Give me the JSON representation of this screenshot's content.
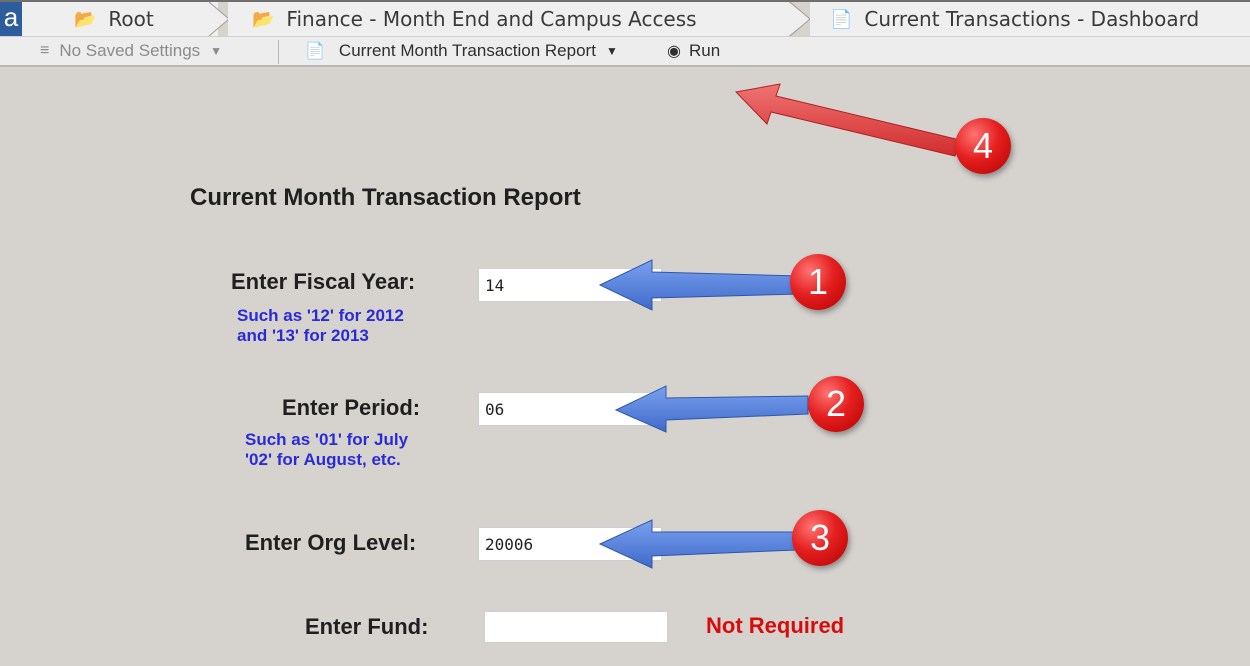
{
  "breadcrumb": {
    "logo_text": "a",
    "items": [
      {
        "label": "Root",
        "icon": "folder-icon"
      },
      {
        "label": "Finance - Month End and Campus Access",
        "icon": "folder-icon"
      },
      {
        "label": "Current Transactions - Dashboard",
        "icon": "document-icon"
      }
    ]
  },
  "toolbar": {
    "saved_settings_label": "No Saved Settings",
    "report_label": "Current Month Transaction Report",
    "run_label": "Run"
  },
  "form": {
    "title": "Current Month Transaction Report",
    "fiscal_year": {
      "label": "Enter Fiscal Year:",
      "hint_line1": "Such as '12' for 2012",
      "hint_line2": "and '13' for 2013",
      "value": "14"
    },
    "period": {
      "label": "Enter Period:",
      "hint_line1": "Such as '01' for July",
      "hint_line2": "'02' for August, etc.",
      "value": "06"
    },
    "org_level": {
      "label": "Enter Org Level:",
      "value": "20006"
    },
    "fund": {
      "label": "Enter Fund:",
      "value": "",
      "note": "Not Required"
    }
  },
  "annotations": {
    "badges": [
      "1",
      "2",
      "3",
      "4"
    ],
    "arrow_color": "#5b82d8",
    "run_arrow_color": "#e44b4b",
    "badge_color": "#e51f1f"
  }
}
